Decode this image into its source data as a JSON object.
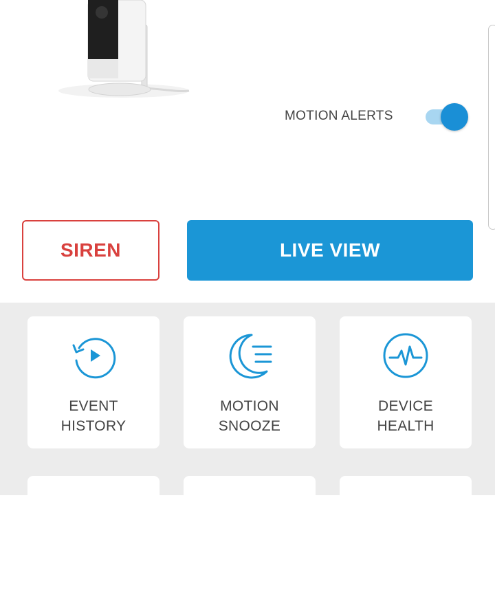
{
  "device": {
    "motion_alerts_label": "MOTION ALERTS",
    "motion_alerts_on": true
  },
  "actions": {
    "siren_label": "SIREN",
    "live_view_label": "LIVE VIEW"
  },
  "tiles": [
    {
      "line1": "EVENT",
      "line2": "HISTORY",
      "icon": "event-history-icon"
    },
    {
      "line1": "MOTION",
      "line2": "SNOOZE",
      "icon": "motion-snooze-icon"
    },
    {
      "line1": "DEVICE",
      "line2": "HEALTH",
      "icon": "device-health-icon"
    }
  ],
  "colors": {
    "accent": "#1b96d6",
    "siren": "#d9413e",
    "toggle_track": "#a8d6f1",
    "panel_bg": "#ececec",
    "text": "#444444"
  }
}
